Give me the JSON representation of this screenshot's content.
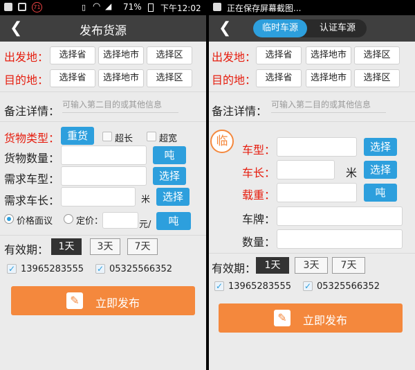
{
  "left": {
    "status": {
      "battery": "71%",
      "time": "下午12:02",
      "notif_count": "71"
    },
    "title": "发布货源",
    "origin_label": "出发地：",
    "dest_label": "目的地：",
    "province": "选择省",
    "city": "选择地市",
    "district": "选择区",
    "remarks_label": "备注详情：",
    "remarks_placeholder": "可输入第二目的或其他信息",
    "cargo_type_label": "货物类型：",
    "heavy": "重货",
    "overlong": "超长",
    "overwide": "超宽",
    "cargo_qty_label": "货物数量：",
    "ton": "吨",
    "vehicle_type_label": "需求车型：",
    "select": "选择",
    "vehicle_length_label": "需求车长：",
    "meter": "米",
    "negotiable": "价格面议",
    "fixed_price": "定价：",
    "yuan_per": "元/",
    "validity_label": "有效期：",
    "day1": "1天",
    "day3": "3天",
    "day7": "7天",
    "phone1": "13965283555",
    "phone2": "05325566352",
    "submit": "立即发布"
  },
  "right": {
    "status": {
      "saving": "正在保存屏幕截图..."
    },
    "tab_temp": "临时车源",
    "tab_cert": "认证车源",
    "origin_label": "出发地：",
    "dest_label": "目的地：",
    "province": "选择省",
    "city": "选择地市",
    "district": "选择区",
    "remarks_label": "备注详情：",
    "remarks_placeholder": "可输入第二目的或其他信息",
    "temp_badge": "临",
    "vtype_label": "车型：",
    "vlength_label": "车长：",
    "load_label": "载重：",
    "plate_label": "车牌：",
    "qty_label": "数量：",
    "select": "选择",
    "meter": "米",
    "ton": "吨",
    "validity_label": "有效期：",
    "day1": "1天",
    "day3": "3天",
    "day7": "7天",
    "phone1": "13965283555",
    "phone2": "05325566352",
    "submit": "立即发布"
  }
}
